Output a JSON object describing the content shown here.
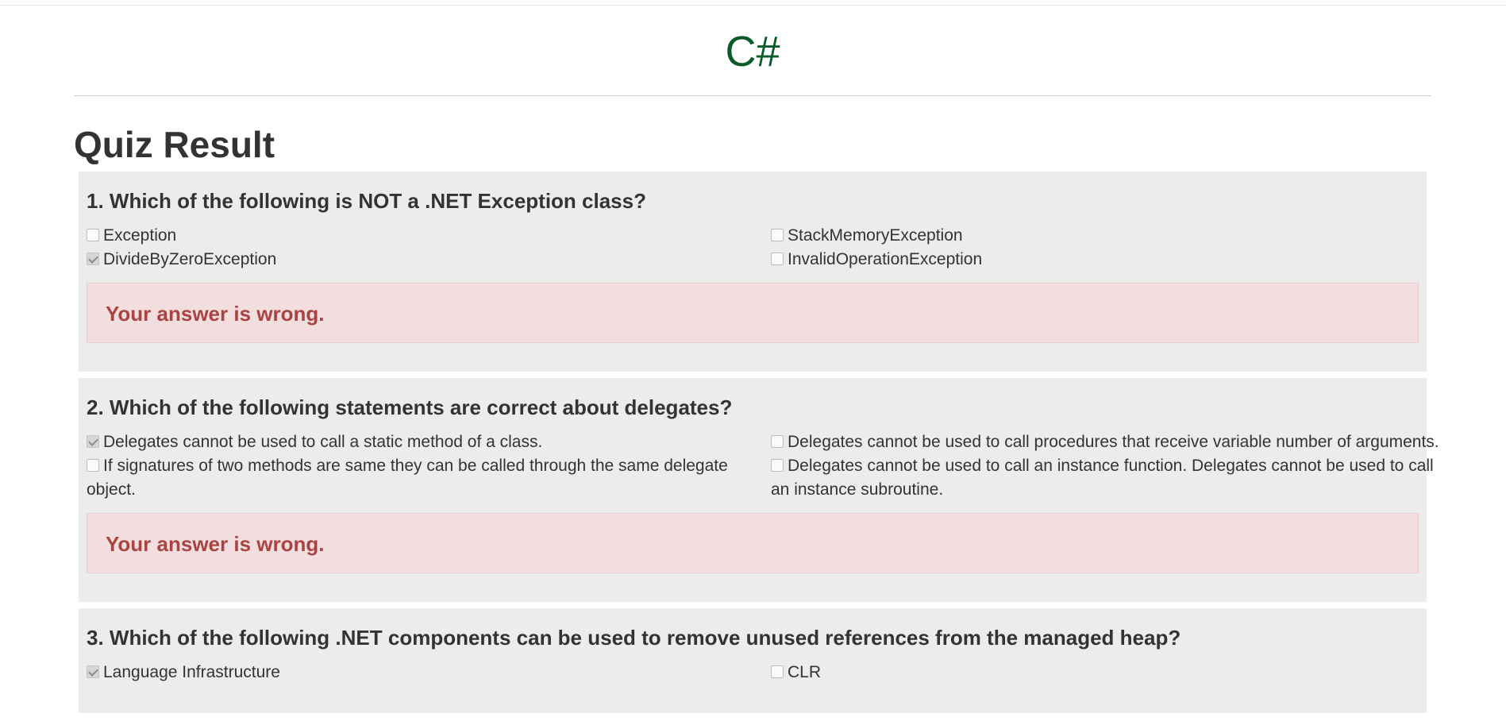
{
  "header": {
    "brand": "C#"
  },
  "page": {
    "title": "Quiz Result"
  },
  "questions": [
    {
      "title": "1. Which of the following is NOT a .NET Exception class?",
      "options": [
        {
          "label": "Exception",
          "checked": false
        },
        {
          "label": "StackMemoryException",
          "checked": false
        },
        {
          "label": "DivideByZeroException",
          "checked": true
        },
        {
          "label": "InvalidOperationException",
          "checked": false
        }
      ],
      "result": "Your answer is wrong."
    },
    {
      "title": "2. Which of the following statements are correct about delegates?",
      "options": [
        {
          "label": "Delegates cannot be used to call a static method of a class.",
          "checked": true
        },
        {
          "label": "Delegates cannot be used to call procedures that receive variable number of arguments.",
          "checked": false
        },
        {
          "label": "If signatures of two methods are same they can be called through the same delegate object.",
          "checked": false
        },
        {
          "label": "Delegates cannot be used to call an instance function. Delegates cannot be used to call an instance subroutine.",
          "checked": false
        }
      ],
      "result": "Your answer is wrong."
    },
    {
      "title": "3. Which of the following .NET components can be used to remove unused references from the managed heap?",
      "options": [
        {
          "label": "Language Infrastructure",
          "checked": true
        },
        {
          "label": "CLR",
          "checked": false
        }
      ]
    }
  ]
}
